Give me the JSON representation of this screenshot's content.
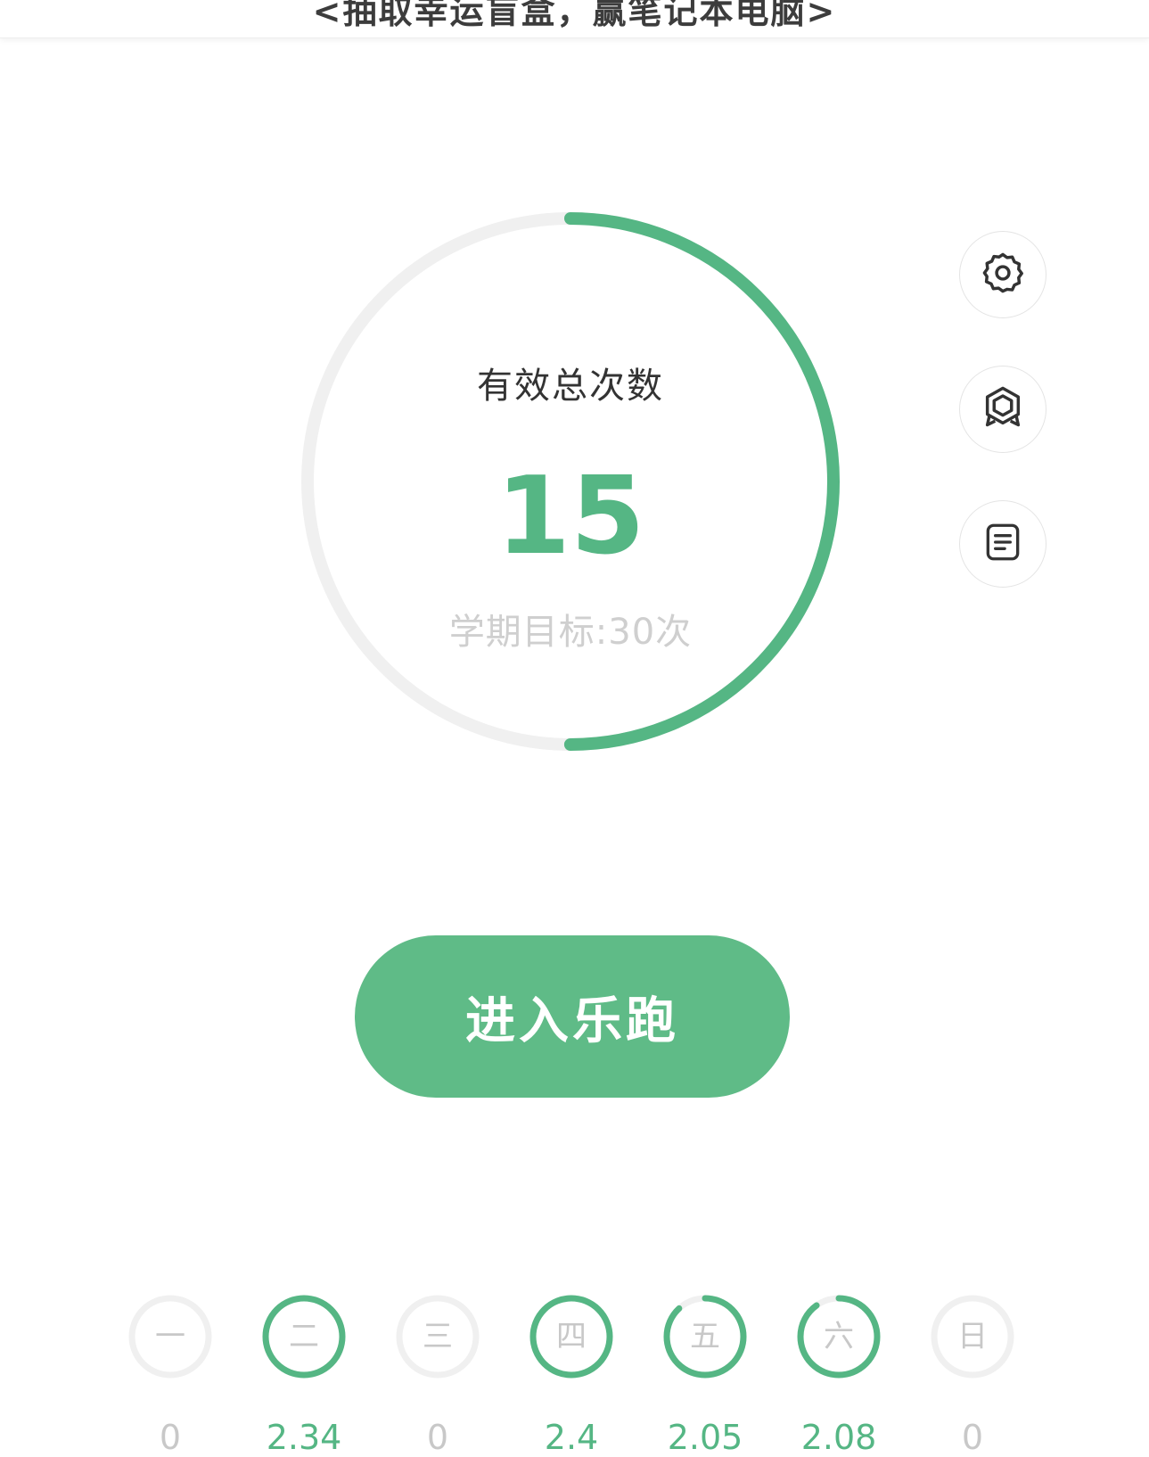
{
  "banner": {
    "text": "<抽取幸运盲盒，赢笔记本电脑>"
  },
  "summary": {
    "title": "有效总次数",
    "value": "15",
    "goal_label": "学期目标:30次",
    "progress_fraction": 0.5
  },
  "side_buttons": [
    {
      "name": "settings",
      "icon": "gear-icon"
    },
    {
      "name": "medal",
      "icon": "hexagon-badge-icon"
    },
    {
      "name": "records",
      "icon": "document-icon"
    }
  ],
  "primary_button": {
    "label": "进入乐跑"
  },
  "week": [
    {
      "day": "一",
      "distance": "0",
      "progress": 0
    },
    {
      "day": "二",
      "distance": "2.34",
      "progress": 1
    },
    {
      "day": "三",
      "distance": "0",
      "progress": 0
    },
    {
      "day": "四",
      "distance": "2.4",
      "progress": 1
    },
    {
      "day": "五",
      "distance": "2.05",
      "progress": 0.88
    },
    {
      "day": "六",
      "distance": "2.08",
      "progress": 0.9
    },
    {
      "day": "日",
      "distance": "0",
      "progress": 0
    }
  ],
  "colors": {
    "accent": "#55b684",
    "button": "#5fbb87",
    "track": "#f0f0f0",
    "muted_text": "#c8c8c8"
  }
}
